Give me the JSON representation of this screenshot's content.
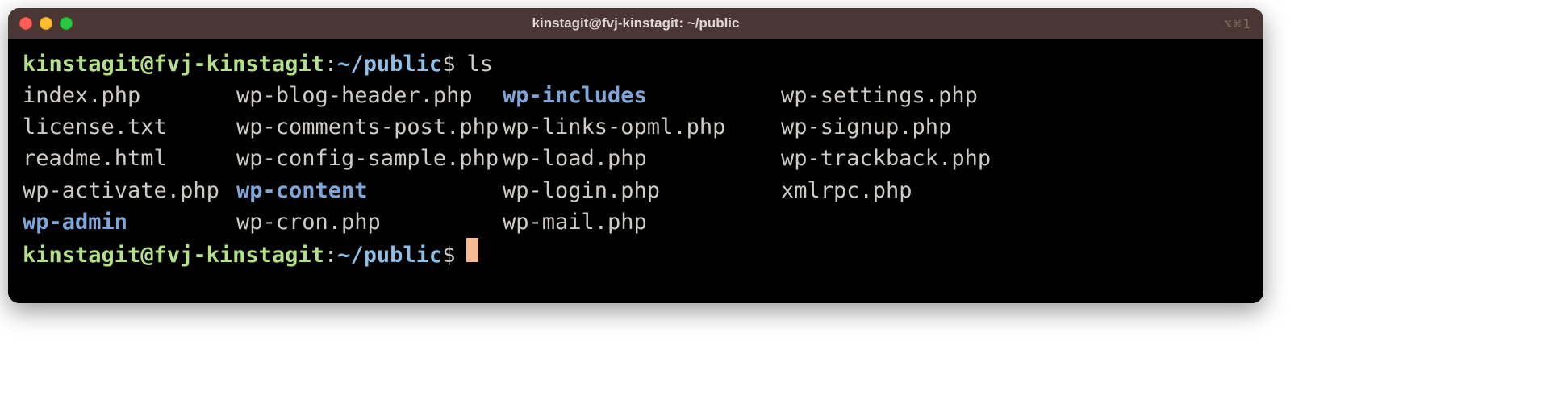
{
  "window": {
    "title": "kinstagit@fvj-kinstagit: ~/public",
    "right_glyph": "⌥⌘1"
  },
  "prompt1": {
    "userhost": "kinstagit@fvj-kinstagit",
    "path": "~/public",
    "symbol": "$",
    "command": "ls"
  },
  "ls": {
    "rows": [
      [
        {
          "name": "index.php",
          "dir": false
        },
        {
          "name": "wp-blog-header.php",
          "dir": false
        },
        {
          "name": "wp-includes",
          "dir": true
        },
        {
          "name": "wp-settings.php",
          "dir": false
        }
      ],
      [
        {
          "name": "license.txt",
          "dir": false
        },
        {
          "name": "wp-comments-post.php",
          "dir": false
        },
        {
          "name": "wp-links-opml.php",
          "dir": false
        },
        {
          "name": "wp-signup.php",
          "dir": false
        }
      ],
      [
        {
          "name": "readme.html",
          "dir": false
        },
        {
          "name": "wp-config-sample.php",
          "dir": false
        },
        {
          "name": "wp-load.php",
          "dir": false
        },
        {
          "name": "wp-trackback.php",
          "dir": false
        }
      ],
      [
        {
          "name": "wp-activate.php",
          "dir": false
        },
        {
          "name": "wp-content",
          "dir": true
        },
        {
          "name": "wp-login.php",
          "dir": false
        },
        {
          "name": "xmlrpc.php",
          "dir": false
        }
      ],
      [
        {
          "name": "wp-admin",
          "dir": true
        },
        {
          "name": "wp-cron.php",
          "dir": false
        },
        {
          "name": "wp-mail.php",
          "dir": false
        },
        {
          "name": "",
          "dir": false
        }
      ]
    ]
  },
  "prompt2": {
    "userhost": "kinstagit@fvj-kinstagit",
    "path": "~/public",
    "symbol": "$"
  }
}
